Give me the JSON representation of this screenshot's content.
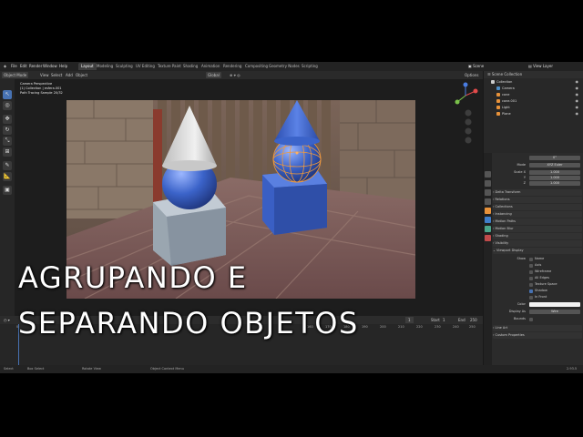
{
  "topbar": {
    "menus": [
      "File",
      "Edit",
      "Render",
      "Window",
      "Help"
    ],
    "workspaces": [
      "Layout",
      "Modeling",
      "Sculpting",
      "UV Editing",
      "Texture Paint",
      "Shading",
      "Animation",
      "Rendering",
      "Compositing",
      "Geometry Nodes",
      "Scripting"
    ],
    "scene": "Scene",
    "view_layer": "View Layer"
  },
  "viewport_header": {
    "mode": "Object Mode",
    "menus": [
      "View",
      "Select",
      "Add",
      "Object"
    ],
    "transform": "Global",
    "options": "Options"
  },
  "viewport": {
    "camera_info": "Camera Perspective",
    "collection_info": "(1) Collection | esfera.001",
    "render_info": "Path Tracing Sample 20/32"
  },
  "timeline": {
    "start_label": "Start",
    "start_value": "1",
    "end_label": "End",
    "end_value": "250",
    "current_frame": "1",
    "ticks": [
      "0",
      "10",
      "20",
      "30",
      "40",
      "50",
      "60",
      "70",
      "80",
      "90",
      "100",
      "110",
      "120",
      "130",
      "140",
      "150",
      "160",
      "170",
      "180",
      "190",
      "200",
      "210",
      "220",
      "230",
      "240",
      "250"
    ]
  },
  "statusbar": {
    "select": "Select",
    "box_select": "Box Select",
    "rotate": "Rotate View",
    "context_menu": "Object Context Menu",
    "version": "2.93.5"
  },
  "outliner": {
    "title": "Scene Collection",
    "items": [
      {
        "name": "Collection",
        "color": "#cccccc"
      },
      {
        "name": "Camera",
        "color": "#4d8ec7"
      },
      {
        "name": "cone",
        "color": "#e8923a"
      },
      {
        "name": "cone.001",
        "color": "#e8923a"
      },
      {
        "name": "Light",
        "color": "#e8923a"
      },
      {
        "name": "Plane",
        "color": "#e8923a"
      }
    ]
  },
  "properties": {
    "mode_label": "Mode",
    "mode_value": "XYZ Euler",
    "scale_label": "Scale X",
    "scale_values": [
      "1.000",
      "1.000",
      "1.000"
    ],
    "scale_axis_labels": [
      "Y",
      "Z"
    ],
    "sections": [
      "Delta Transform",
      "Relations",
      "Collections",
      "Instancing",
      "Motion Paths",
      "Motion Blur",
      "Shading",
      "Visibility",
      "Viewport Display"
    ],
    "viewport_display": {
      "show_label": "Show",
      "options": [
        {
          "label": "Name",
          "on": false
        },
        {
          "label": "Axis",
          "on": false
        },
        {
          "label": "Wireframe",
          "on": false
        },
        {
          "label": "All Edges",
          "on": false
        },
        {
          "label": "Texture Space",
          "on": false
        },
        {
          "label": "Shadow",
          "on": true
        },
        {
          "label": "In Front",
          "on": false
        }
      ],
      "color_label": "Color",
      "display_as_label": "Display As",
      "display_as_value": "Wire",
      "bounds_label": "Bounds"
    },
    "footer_sections": [
      "Line Art",
      "Custom Properties"
    ]
  },
  "overlay": {
    "line1": "AGRUPANDO E",
    "line2": "SEPARANDO OBJETOS"
  },
  "colors": {
    "accent": "#4772b3",
    "object_blue": "#3b63c9",
    "cone_white": "#e6e6e6"
  }
}
